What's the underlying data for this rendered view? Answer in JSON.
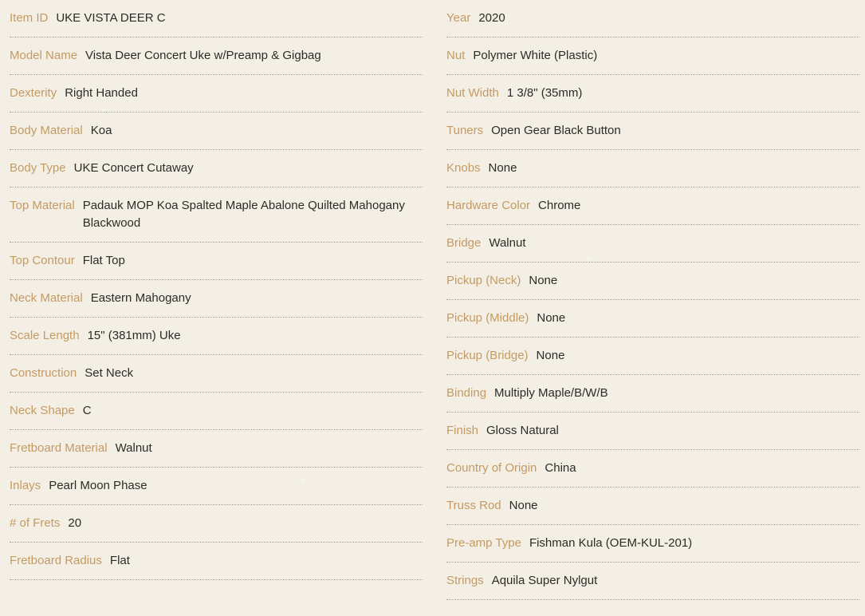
{
  "specs": {
    "left": [
      {
        "label": "Item ID",
        "value": "UKE VISTA DEER C"
      },
      {
        "label": "Model Name",
        "value": "Vista Deer Concert Uke w/Preamp & Gigbag"
      },
      {
        "label": "Dexterity",
        "value": "Right Handed"
      },
      {
        "label": "Body Material",
        "value": "Koa"
      },
      {
        "label": "Body Type",
        "value": "UKE Concert Cutaway"
      },
      {
        "label": "Top Material",
        "value": "Padauk MOP Koa Spalted Maple Abalone Quilted Mahogany Blackwood"
      },
      {
        "label": "Top Contour",
        "value": "Flat Top"
      },
      {
        "label": "Neck Material",
        "value": "Eastern Mahogany"
      },
      {
        "label": "Scale Length",
        "value": "15\" (381mm) Uke"
      },
      {
        "label": "Construction",
        "value": "Set Neck"
      },
      {
        "label": "Neck Shape",
        "value": "C"
      },
      {
        "label": "Fretboard Material",
        "value": "Walnut"
      },
      {
        "label": "Inlays",
        "value": "Pearl Moon Phase"
      },
      {
        "label": "# of Frets",
        "value": "20"
      },
      {
        "label": "Fretboard Radius",
        "value": "Flat"
      }
    ],
    "right": [
      {
        "label": "Year",
        "value": "2020"
      },
      {
        "label": "Nut",
        "value": "Polymer White (Plastic)"
      },
      {
        "label": "Nut Width",
        "value": "1 3/8\" (35mm)"
      },
      {
        "label": "Tuners",
        "value": "Open Gear Black Button"
      },
      {
        "label": "Knobs",
        "value": "None"
      },
      {
        "label": "Hardware Color",
        "value": "Chrome"
      },
      {
        "label": "Bridge",
        "value": "Walnut"
      },
      {
        "label": "Pickup (Neck)",
        "value": "None"
      },
      {
        "label": "Pickup (Middle)",
        "value": "None"
      },
      {
        "label": "Pickup (Bridge)",
        "value": "None"
      },
      {
        "label": "Binding",
        "value": "Multiply Maple/B/W/B"
      },
      {
        "label": "Finish",
        "value": "Gloss Natural"
      },
      {
        "label": "Country of Origin",
        "value": "China"
      },
      {
        "label": "Truss Rod",
        "value": "None"
      },
      {
        "label": "Pre-amp Type",
        "value": "Fishman Kula (OEM-KUL-201)"
      },
      {
        "label": "Strings",
        "value": "Aquila Super Nylgut"
      }
    ]
  }
}
